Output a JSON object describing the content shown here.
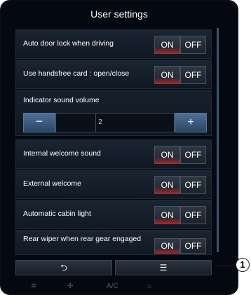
{
  "title": "User settings",
  "settings": [
    {
      "label": "Auto door lock when driving",
      "on": "ON",
      "off": "OFF"
    },
    {
      "label": "Use handsfree card : open/close",
      "on": "ON",
      "off": "OFF"
    },
    {
      "label": "Internal welcome sound",
      "on": "ON",
      "off": "OFF"
    },
    {
      "label": "External welcome",
      "on": "ON",
      "off": "OFF"
    },
    {
      "label": "Automatic cabin light",
      "on": "ON",
      "off": "OFF"
    },
    {
      "label": "Rear wiper when rear gear engaged",
      "on": "ON",
      "off": "OFF"
    }
  ],
  "volume": {
    "label": "Indicator sound volume",
    "value": "2",
    "minus": "−",
    "plus": "+"
  },
  "bottom": {
    "back": "⮌",
    "menu": "☰"
  },
  "icons": {
    "fan": "fan-icon",
    "recirc": "recirculation-icon",
    "ac": "A/C",
    "defrost": "defrost-icon"
  },
  "callout": "1",
  "colors": {
    "accent_on": "#b41d1d",
    "background": "#040810",
    "volume_buttons": "#3f5e83"
  }
}
